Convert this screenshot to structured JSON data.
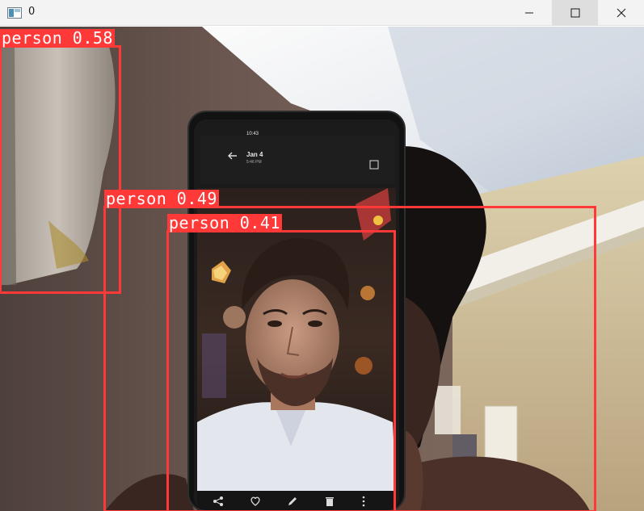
{
  "window": {
    "title": "0",
    "icons": {
      "app": "opencv-window-icon",
      "minimize": "minimize-icon",
      "maximize": "maximize-icon",
      "close": "close-icon"
    }
  },
  "detections": [
    {
      "label": "person 0.58",
      "class": "person",
      "confidence": 0.58
    },
    {
      "label": "person 0.49",
      "class": "person",
      "confidence": 0.49
    },
    {
      "label": "person 0.41",
      "class": "person",
      "confidence": 0.41
    }
  ],
  "phone": {
    "time": "10:43",
    "date": "Jan 4",
    "clock": "5:46 PM",
    "toolbar_icons": [
      "share-icon",
      "heart-icon",
      "edit-icon",
      "trash-icon",
      "more-icon"
    ]
  },
  "colors": {
    "detection": "#ff3838",
    "label_text": "#ffffff"
  }
}
